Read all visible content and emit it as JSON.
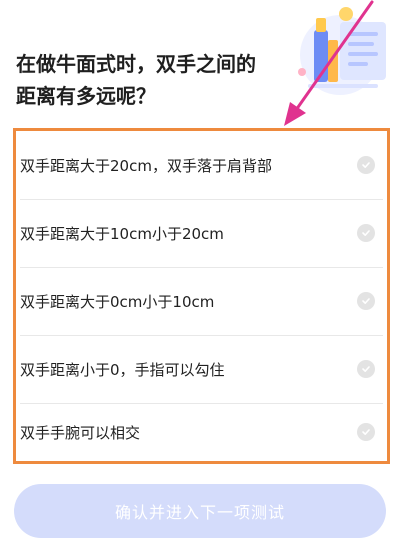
{
  "question": {
    "line1": "在做牛面式时，双手之间的",
    "line2": "距离有多远呢？"
  },
  "options": [
    {
      "label": "双手距离大于20cm，双手落于肩背部",
      "icon": "check-circle-icon"
    },
    {
      "label": "双手距离大于10cm小于20cm",
      "icon": "check-circle-icon"
    },
    {
      "label": "双手距离大于0cm小于10cm",
      "icon": "check-circle-icon"
    },
    {
      "label": "双手距离小于0，手指可以勾住",
      "icon": "check-circle-icon"
    },
    {
      "label": "双手手腕可以相交",
      "icon": "check-circle-icon"
    }
  ],
  "confirm_button": {
    "label": "确认并进入下一项测试"
  },
  "colors": {
    "highlight_border": "#ee8a3e",
    "annotation_arrow": "#e0338f",
    "button_disabled": "#d4dcfb",
    "check_idle": "#e3e3e3"
  }
}
